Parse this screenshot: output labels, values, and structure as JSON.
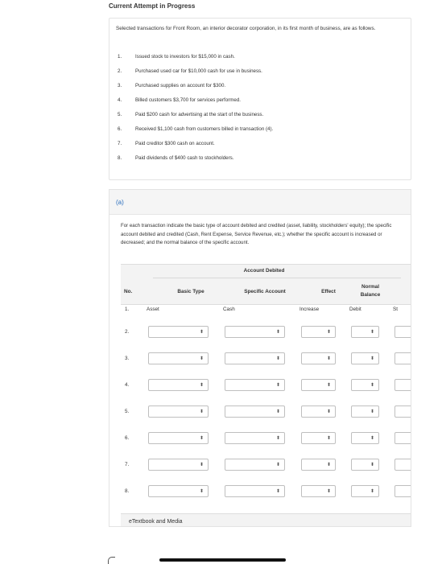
{
  "page": {
    "title": "Current Attempt in Progress"
  },
  "problem": {
    "intro": "Selected transactions for Front Room, an interior decorator corporation, in its first month of business, are as follows.",
    "transactions": [
      {
        "num": "1.",
        "text": "Issued stock to investors for $15,000 in cash."
      },
      {
        "num": "2.",
        "text": "Purchased used car for $10,000 cash for use in business."
      },
      {
        "num": "3.",
        "text": "Purchased supplies on account for $300."
      },
      {
        "num": "4.",
        "text": "Billed customers $3,700 for services performed."
      },
      {
        "num": "5.",
        "text": "Paid $200 cash for advertising at the start of the business."
      },
      {
        "num": "6.",
        "text": "Received $1,100 cash from customers billed in transaction (4)."
      },
      {
        "num": "7.",
        "text": "Paid creditor $300 cash on account."
      },
      {
        "num": "8.",
        "text": "Paid dividends of $400 cash to stockholders."
      }
    ]
  },
  "part_a": {
    "label": "(a)",
    "instructions": "For each transaction indicate the basic type of account debited and credited (asset, liability, stockholders' equity); the specific account debited and credited (Cash, Rent Expense, Service Revenue, etc.); whether the specific account is increased or decreased; and the normal balance of the specific account.",
    "table": {
      "group_header": "Account Debited",
      "columns": [
        "No.",
        "Basic Type",
        "Specific Account",
        "Effect",
        "Normal Balance",
        "St"
      ],
      "example_row": {
        "no": "1.",
        "basic_type": "Asset",
        "specific_account": "Cash",
        "effect": "Increase",
        "normal_balance": "Debit",
        "cut": "St"
      },
      "rows": [
        "2.",
        "3.",
        "4.",
        "5.",
        "6.",
        "7.",
        "8."
      ]
    }
  },
  "footer": {
    "etextbook": "eTextbook and Media"
  },
  "icons": {
    "dropdown": "chevron-updown-icon"
  }
}
